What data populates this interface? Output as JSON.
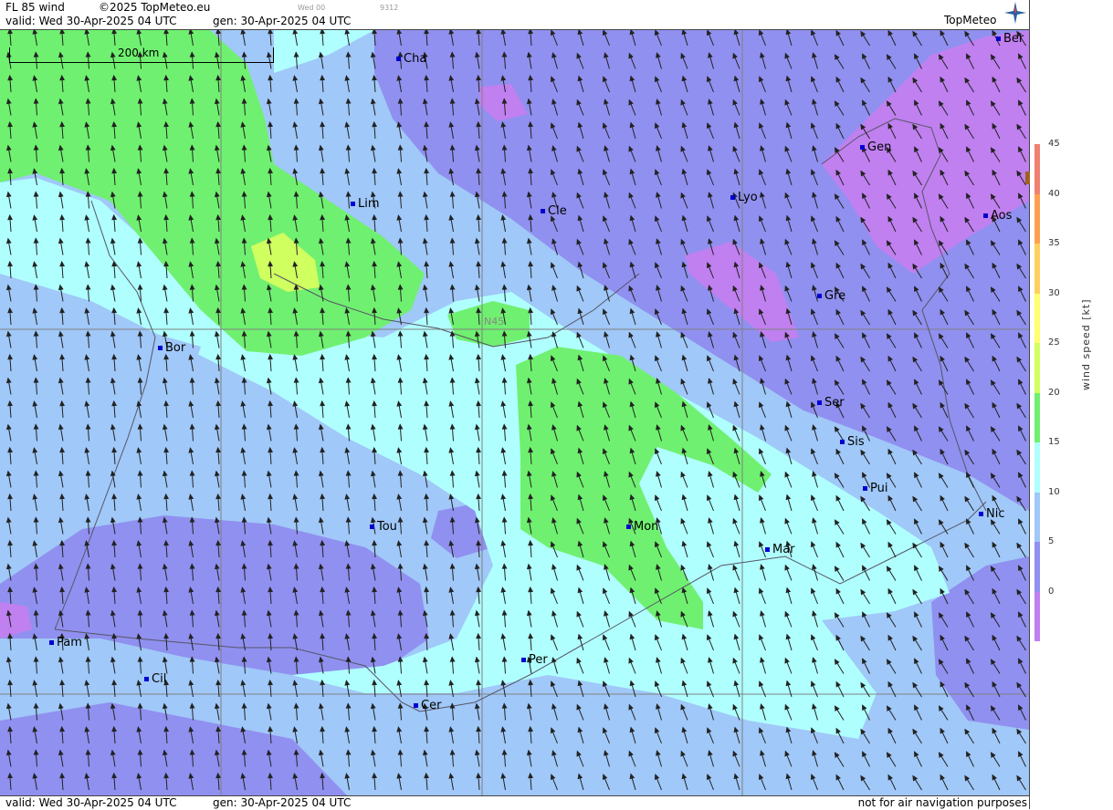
{
  "header": {
    "product": "FL 85 wind",
    "copyright": "©2025 TopMeteo.eu",
    "run_label": "Wed 00",
    "code": "9312",
    "valid": "valid:  Wed  30-Apr-2025  04 UTC",
    "gen": "gen: 30-Apr-2025 04 UTC"
  },
  "footer": {
    "valid": "valid:  Wed  30-Apr-2025  04 UTC",
    "gen": "gen: 30-Apr-2025 04 UTC",
    "disclaimer": "not for air navigation purposes"
  },
  "logo": {
    "text": "TopMeteo"
  },
  "scale": {
    "label": "200 km"
  },
  "grid_label": "N45",
  "legend": {
    "title": "wind speed [kt]",
    "ticks": [
      "45",
      "40",
      "35",
      "30",
      "25",
      "20",
      "15",
      "10",
      "5",
      "0"
    ],
    "colors": [
      "#f08070",
      "#ffa050",
      "#ffd060",
      "#ffff70",
      "#d0ff60",
      "#70f070",
      "#b0ffff",
      "#a0c8f8",
      "#9090f0",
      "#c080f0"
    ]
  },
  "colors": {
    "calm": "#c080f0",
    "light": "#9090f0",
    "moderate": "#a0c8f8",
    "fresh": "#b0ffff",
    "strong": "#70f070",
    "stronger": "#d0ff60",
    "city_marker": "#0000d0"
  },
  "cities": [
    {
      "name": "Cha"
    },
    {
      "name": "Ber"
    },
    {
      "name": "Gen"
    },
    {
      "name": "Lim"
    },
    {
      "name": "Cle"
    },
    {
      "name": "Lyo"
    },
    {
      "name": "Aos"
    },
    {
      "name": "Gre"
    },
    {
      "name": "Bor"
    },
    {
      "name": "Ser"
    },
    {
      "name": "Sis"
    },
    {
      "name": "Pui"
    },
    {
      "name": "Nic"
    },
    {
      "name": "Tou"
    },
    {
      "name": "Mon"
    },
    {
      "name": "Mar"
    },
    {
      "name": "Pam"
    },
    {
      "name": "Cil"
    },
    {
      "name": "Per"
    },
    {
      "name": "Cer"
    }
  ]
}
